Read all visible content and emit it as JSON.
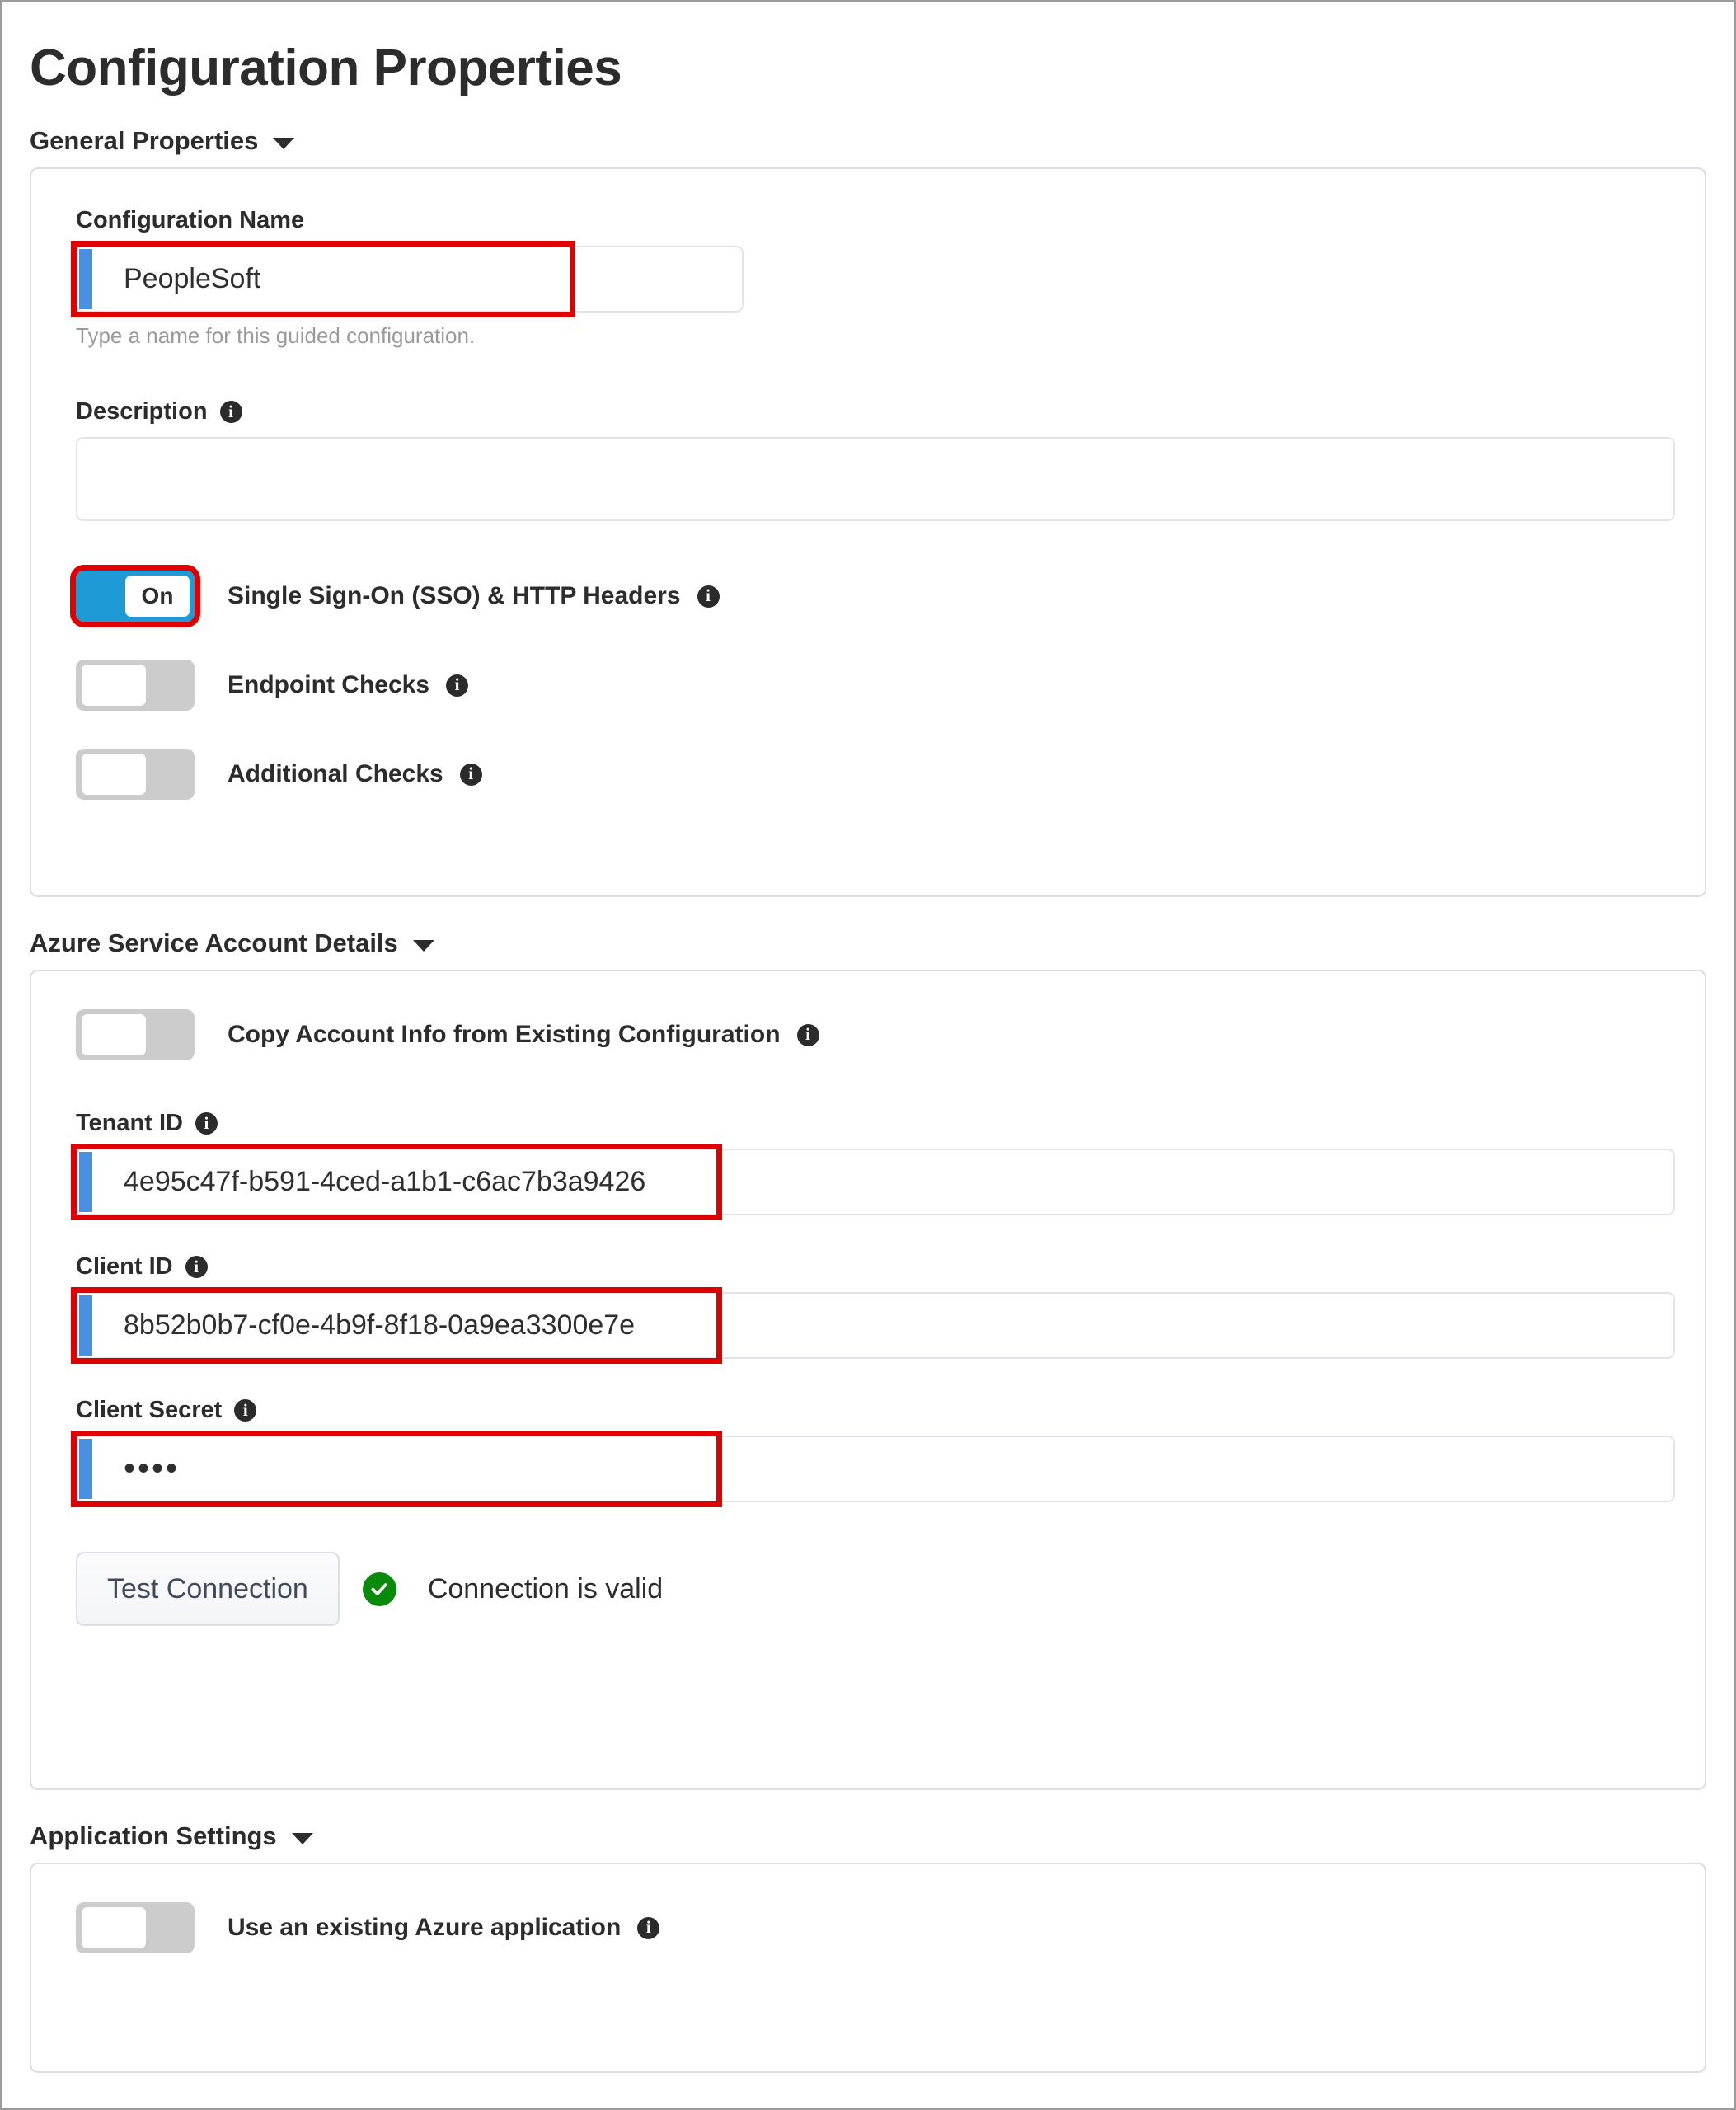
{
  "page": {
    "title": "Configuration Properties"
  },
  "colors": {
    "highlight": "#e00000",
    "toggle_on": "#1e9bd7",
    "toggle_off": "#cccccc",
    "input_accent": "#4a90e2",
    "status_ok": "#0a8a0a",
    "panel_border": "#dcdee5"
  },
  "sections": {
    "general": {
      "header": "General Properties",
      "caret": "chevron-down-icon",
      "config_name": {
        "label": "Configuration Name",
        "value": "PeopleSoft",
        "placeholder": "",
        "hint": "Type a name for this guided configuration.",
        "highlighted": true
      },
      "description": {
        "label": "Description",
        "info": "info-icon",
        "value": "",
        "placeholder": ""
      },
      "toggles": [
        {
          "label": "Single Sign-On (SSO) & HTTP Headers",
          "state": "On",
          "on": true,
          "info": "info-icon",
          "highlighted": true
        },
        {
          "label": "Endpoint Checks",
          "state": "Off",
          "on": false,
          "info": "info-icon",
          "highlighted": false
        },
        {
          "label": "Additional Checks",
          "state": "Off",
          "on": false,
          "info": "info-icon",
          "highlighted": false
        }
      ]
    },
    "azure": {
      "header": "Azure Service Account Details",
      "caret": "chevron-down-icon",
      "copy_toggle": {
        "label": "Copy Account Info from Existing Configuration",
        "state": "Off",
        "on": false,
        "info": "info-icon"
      },
      "tenant_id": {
        "label": "Tenant ID",
        "info": "info-icon",
        "value": "4e95c47f-b591-4ced-a1b1-c6ac7b3a9426",
        "highlighted": true
      },
      "client_id": {
        "label": "Client ID",
        "info": "info-icon",
        "value": "8b52b0b7-cf0e-4b9f-8f18-0a9ea3300e7e",
        "highlighted": true
      },
      "client_secret": {
        "label": "Client Secret",
        "info": "info-icon",
        "value": "••••",
        "highlighted": true
      },
      "test_button": "Test Connection",
      "status": {
        "icon": "check-circle-icon",
        "text": "Connection is valid"
      }
    },
    "app_settings": {
      "header": "Application Settings",
      "caret": "chevron-down-icon",
      "use_existing_toggle": {
        "label": "Use an existing Azure application",
        "state": "Off",
        "on": false,
        "info": "info-icon"
      }
    }
  }
}
